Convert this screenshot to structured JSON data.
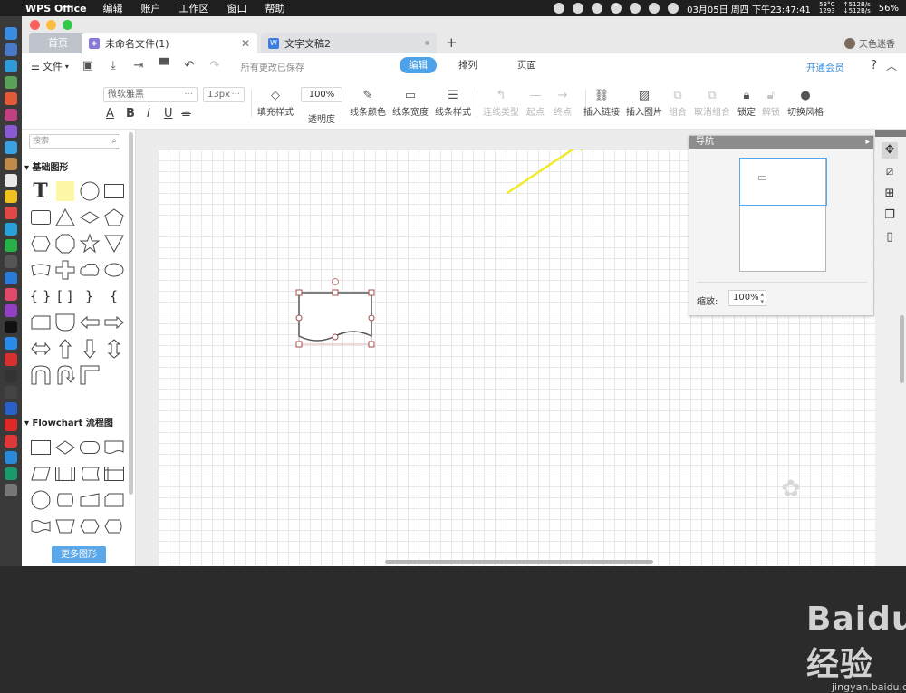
{
  "menubar": {
    "app": "WPS Office",
    "items": [
      "编辑",
      "账户",
      "工作区",
      "窗口",
      "帮助"
    ],
    "temp": "53°C",
    "rpm": "1293",
    "net_up": "↑512B/s",
    "net_down": "↓512B/s",
    "datetime": "03月05日 周四 下午23:47:41",
    "battery": "56%"
  },
  "tabs": {
    "home": "首页",
    "active": "未命名文件(1)",
    "inactive": "文字文稿2",
    "add": "+"
  },
  "user": {
    "name": "天色迷香"
  },
  "toolbar1": {
    "file": "文件",
    "saved": "所有更改已保存",
    "modes": [
      "编辑",
      "排列",
      "页面"
    ],
    "vip": "开通会员",
    "help": "?"
  },
  "toolbar2": {
    "font": "微软雅黑",
    "size": "13px",
    "fill": "填充样式",
    "opacity_value": "100%",
    "opacity": "透明度",
    "line_color": "线条颜色",
    "line_width": "线条宽度",
    "line_style": "线条样式",
    "conn_type": "连线类型",
    "start": "起点",
    "end": "终点",
    "insert_link": "插入链接",
    "insert_image": "插入图片",
    "group": "组合",
    "ungroup": "取消组合",
    "lock": "锁定",
    "unlock": "解锁",
    "style": "切换风格"
  },
  "left": {
    "search_placeholder": "搜索",
    "section1": "基础图形",
    "section2": "Flowchart 流程图",
    "more": "更多图形"
  },
  "navigator": {
    "title": "导航",
    "zoom_label": "缩放:",
    "zoom_value": "100%"
  },
  "watermark": {
    "brand": "Baidu经验",
    "url": "jingyan.baidu.com"
  }
}
